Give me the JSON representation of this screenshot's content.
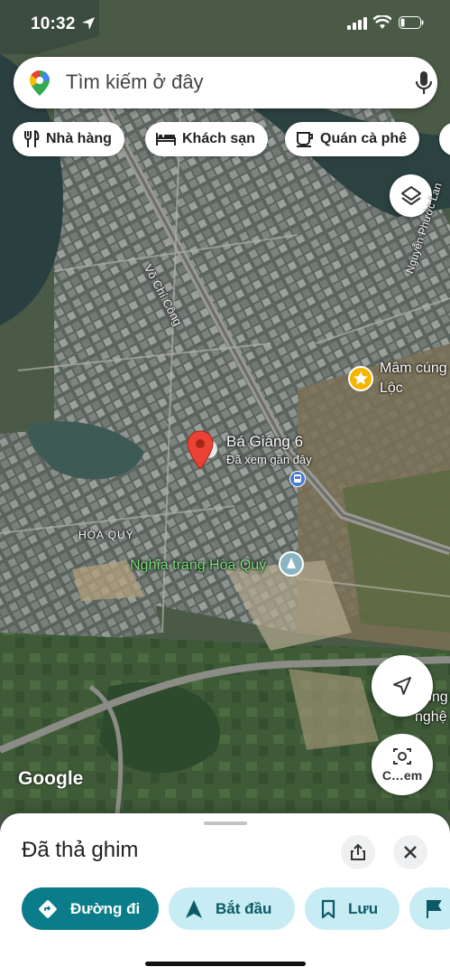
{
  "status_bar": {
    "time": "10:32"
  },
  "search": {
    "placeholder": "Tìm kiếm ở đây"
  },
  "chips": [
    {
      "label": "Nhà hàng",
      "icon": "restaurant-icon"
    },
    {
      "label": "Khách sạn",
      "icon": "hotel-icon"
    },
    {
      "label": "Quán cà phê",
      "icon": "coffee-icon"
    }
  ],
  "map": {
    "pin": {
      "title": "Bá Giáng 6",
      "subtitle": "Đã xem gần đây"
    },
    "labels": {
      "ward": "HÒA QUÝ",
      "cemetery": "Nghĩa trang Hòa Quý",
      "poi_line1": "Mâm cúng",
      "poi_line2": "Lộc",
      "road_vo_chi_cong": "Võ Chí Công",
      "road_nguyen": "Nguyễn Phước Lan",
      "edge_line1": "ông",
      "edge_line2": "nghệ"
    },
    "google_logo": "Google",
    "camera_button_label": "C…em"
  },
  "sheet": {
    "title": "Đã thả ghim",
    "actions": [
      {
        "label": "Đường đi",
        "icon": "directions-icon"
      },
      {
        "label": "Bắt đầu",
        "icon": "navigate-icon"
      },
      {
        "label": "Lưu",
        "icon": "bookmark-icon"
      },
      {
        "label": "",
        "icon": "flag-icon"
      }
    ]
  },
  "colors": {
    "primary_action": "#0b7c89",
    "secondary_action_bg": "#c7ecf3",
    "pin_red": "#ea4335",
    "poi_star": "#f4b400"
  }
}
